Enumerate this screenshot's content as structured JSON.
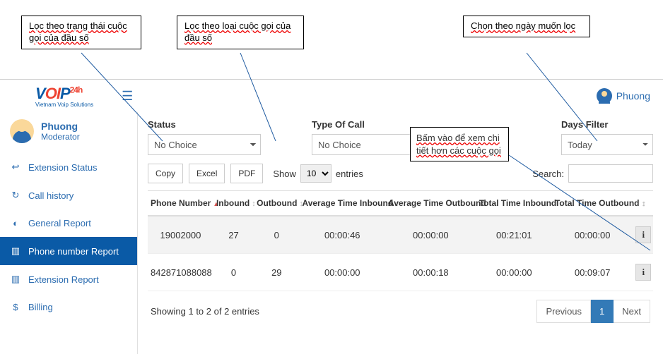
{
  "annotations": {
    "status": "Lọc theo trạng thái cuộc gọi của đầu số",
    "type": "Lọc theo loại cuộc gọi của đầu số",
    "days": "Chọn theo ngày muốn lọc",
    "info": "Bấm vào để xem chi tiết hơn các cuộc gọi"
  },
  "header": {
    "user_name": "Phuong"
  },
  "sidebar": {
    "user": {
      "name": "Phuong",
      "role": "Moderator"
    },
    "items": [
      {
        "icon": "↩",
        "label": "Extension Status"
      },
      {
        "icon": "↻",
        "label": "Call history"
      },
      {
        "icon": "◐",
        "label": "General Report"
      },
      {
        "icon": "▥",
        "label": "Phone number Report"
      },
      {
        "icon": "▥",
        "label": "Extension Report"
      },
      {
        "icon": "$",
        "label": "Billing"
      }
    ]
  },
  "filters": {
    "status": {
      "label": "Status",
      "value": "No Choice"
    },
    "type_of_call": {
      "label": "Type Of Call",
      "value": "No Choice"
    },
    "days": {
      "label": "Days Filter",
      "value": "Today"
    }
  },
  "toolbar": {
    "copy": "Copy",
    "excel": "Excel",
    "pdf": "PDF",
    "show_pre": "Show",
    "show_value": "10",
    "show_post": "entries",
    "search_label": "Search:"
  },
  "columns": {
    "phone": "Phone Number",
    "inbound": "Inbound",
    "outbound": "Outbound",
    "avg_in": "Average Time Inbound",
    "avg_out": "Average Time Outbound",
    "tot_in": "Total Time Inbound",
    "tot_out": "Total Time Outbound"
  },
  "rows": [
    {
      "phone": "19002000",
      "inbound": "27",
      "outbound": "0",
      "avg_in": "00:00:46",
      "avg_out": "00:00:00",
      "tot_in": "00:21:01",
      "tot_out": "00:00:00"
    },
    {
      "phone": "842871088088",
      "inbound": "0",
      "outbound": "29",
      "avg_in": "00:00:00",
      "avg_out": "00:00:18",
      "tot_in": "00:00:00",
      "tot_out": "00:09:07"
    }
  ],
  "footer": {
    "info": "Showing 1 to 2 of 2 entries",
    "prev": "Previous",
    "page": "1",
    "next": "Next"
  }
}
